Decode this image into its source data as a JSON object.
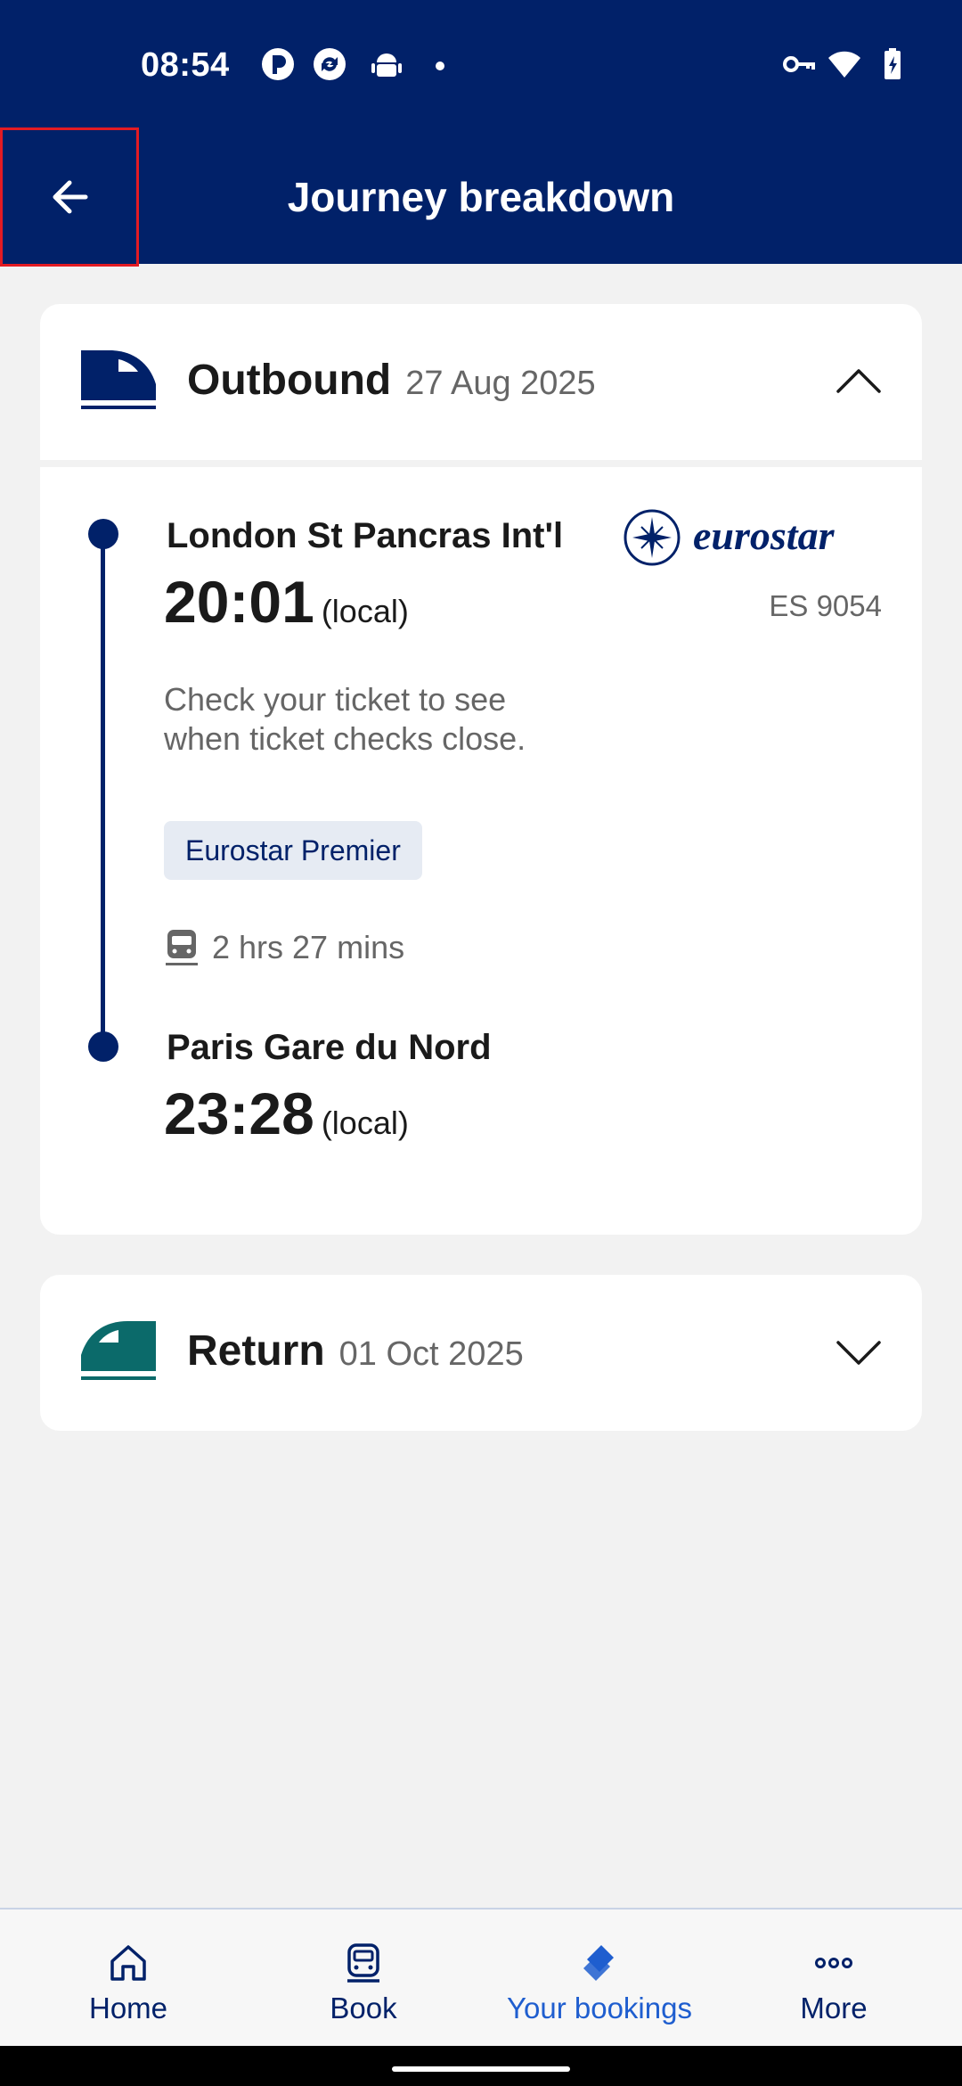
{
  "status_bar": {
    "time": "08:54",
    "icons": [
      "p-app-icon",
      "refresh-app-icon",
      "android-icon",
      "notification-dot-icon",
      "key-icon",
      "wifi-icon",
      "battery-charging-icon"
    ]
  },
  "header": {
    "title": "Journey breakdown",
    "back_icon": "arrow-left-icon"
  },
  "outbound": {
    "label": "Outbound",
    "date": "27 Aug 2025",
    "expanded": true,
    "departure": {
      "station": "London St Pancras Int'l",
      "time": "20:01",
      "time_suffix": "(local)"
    },
    "operator": "eurostar",
    "service_number": "ES 9054",
    "note": "Check your ticket to see when ticket checks close.",
    "class": "Eurostar Premier",
    "duration": "2 hrs 27 mins",
    "arrival": {
      "station": "Paris Gare du Nord",
      "time": "23:28",
      "time_suffix": "(local)"
    }
  },
  "return": {
    "label": "Return",
    "date": "01 Oct 2025",
    "expanded": false
  },
  "bottom_nav": {
    "items": [
      {
        "label": "Home",
        "icon": "home-icon",
        "active": false
      },
      {
        "label": "Book",
        "icon": "train-front-icon",
        "active": false
      },
      {
        "label": "Your bookings",
        "icon": "tickets-icon",
        "active": true
      },
      {
        "label": "More",
        "icon": "more-dots-icon",
        "active": false
      }
    ]
  },
  "colors": {
    "brand_navy": "#012169",
    "return_teal": "#0b6a6a",
    "active_blue": "#1f5ecf",
    "highlight_red": "#e31b23"
  }
}
